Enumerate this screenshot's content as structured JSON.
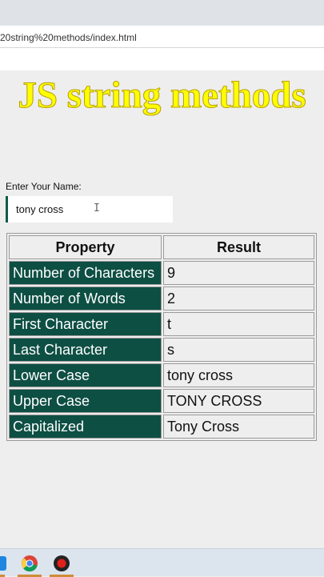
{
  "browser": {
    "url_text": "20string%20methods/index.html"
  },
  "page": {
    "title": "JS string methods",
    "name_label": "Enter Your Name:",
    "name_value": "tony cross"
  },
  "table": {
    "headers": [
      "Property",
      "Result"
    ],
    "rows": [
      {
        "property": "Number of Characters",
        "result": "9"
      },
      {
        "property": "Number of Words",
        "result": "2"
      },
      {
        "property": "First Character",
        "result": "t"
      },
      {
        "property": "Last Character",
        "result": "s"
      },
      {
        "property": "Lower Case",
        "result": "tony cross"
      },
      {
        "property": "Upper Case",
        "result": "TONY CROSS"
      },
      {
        "property": "Capitalized",
        "result": "Tony Cross"
      }
    ]
  },
  "taskbar": {
    "icons": [
      "app-edge-icon",
      "chrome-icon",
      "record-icon"
    ]
  },
  "colors": {
    "title_yellow": "#ffff00",
    "property_cell_bg": "#0e4f44",
    "input_accent": "#0e5a4a"
  }
}
